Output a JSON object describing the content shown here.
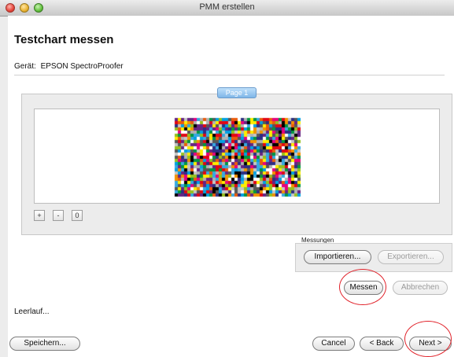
{
  "window": {
    "title": "PMM erstellen"
  },
  "page": {
    "heading": "Testchart messen",
    "device_label": "Gerät:",
    "device_value": "EPSON SpectroProofer"
  },
  "preview": {
    "page_tab": "Page 1",
    "zoom_in": "+",
    "zoom_out": "-",
    "zoom_reset": "0"
  },
  "measurements": {
    "group_label": "Messungen",
    "import_label": "Importieren...",
    "export_label": "Exportieren...",
    "measure_label": "Messen",
    "abort_label": "Abbrechen"
  },
  "status": {
    "text": "Leerlauf..."
  },
  "footer": {
    "save_label": "Speichern...",
    "cancel_label": "Cancel",
    "back_label": "< Back",
    "next_label": "Next >"
  },
  "colors": {
    "annotation": "#e1222a",
    "page_tab": "#7fb6e8"
  }
}
